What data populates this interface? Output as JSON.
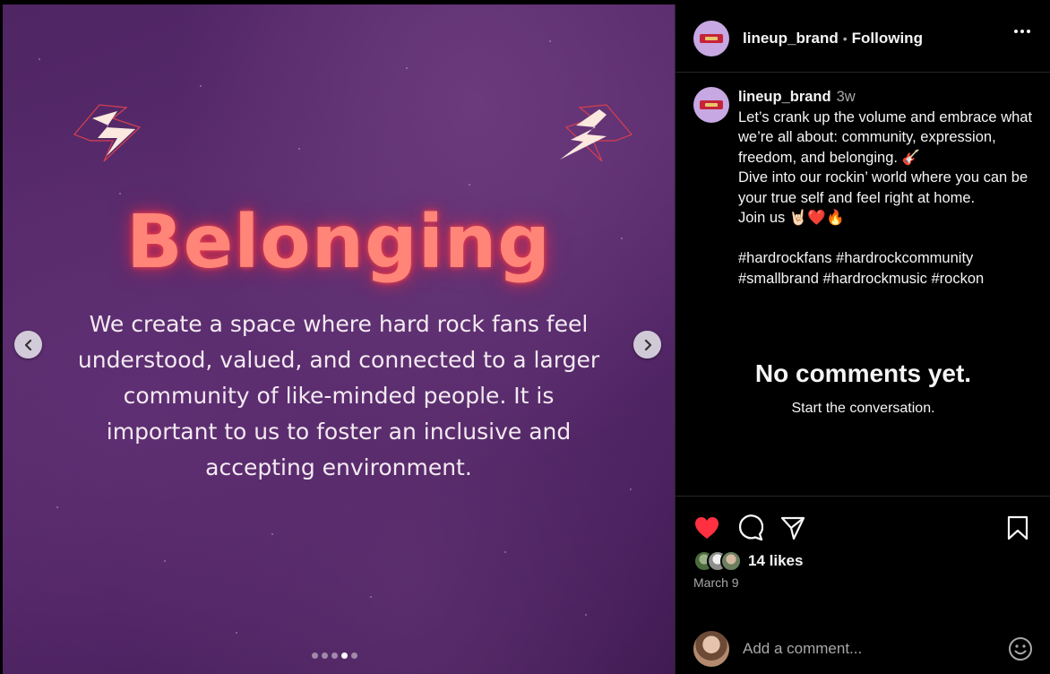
{
  "post": {
    "headline": "Belonging",
    "body": "We create a space where hard rock fans feel understood, valued, and connected to a larger community of like-minded people. It is important to us to foster an inclusive and accepting environment.",
    "carousel": {
      "slide_count": 5,
      "active_index": 3
    }
  },
  "header": {
    "username": "lineup_brand",
    "separator": "•",
    "follow_status": "Following"
  },
  "caption": {
    "username": "lineup_brand",
    "time": "3w",
    "text": "Let’s crank up the volume and embrace what we’re all about: community, expression, freedom, and belonging. 🎸\nDive into our rockin’ world where you can be your true self and feel right at home.\nJoin us 🤘🏻❤️🔥\n\n#hardrockfans #hardrockcommunity\n#smallbrand #hardrockmusic #rockon"
  },
  "comments": {
    "empty_title": "No comments yet.",
    "empty_subtitle": "Start the conversation."
  },
  "actions": {
    "liked": true,
    "like_color": "#ff3040",
    "icons": [
      "heart-icon",
      "comment-icon",
      "share-icon",
      "bookmark-icon"
    ]
  },
  "likes": {
    "text": "14 likes"
  },
  "date": "March 9",
  "comment_box": {
    "placeholder": "Add a comment..."
  },
  "colors": {
    "headline_glow": "#ff8579",
    "background_purple": "#4f2563",
    "brand_avatar": "#c7a8e2"
  }
}
